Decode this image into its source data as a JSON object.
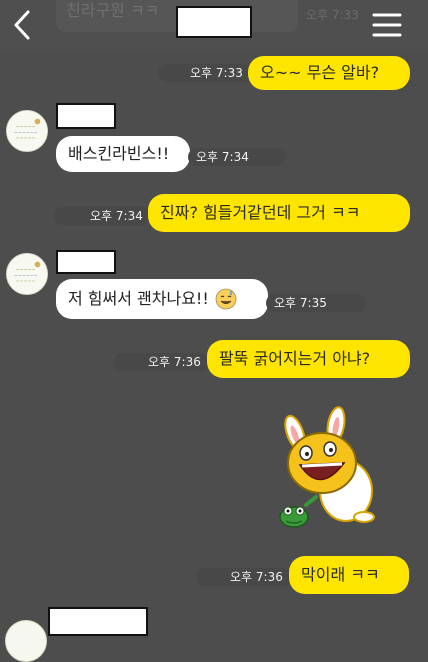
{
  "header": {
    "back_icon": "chevron-left-icon",
    "menu_icon": "hamburger-menu-icon"
  },
  "partial_top": {
    "text": "친라구원 ㅋㅋ",
    "time": "오후 7:33"
  },
  "messages": [
    {
      "side": "me",
      "text": "오~~ 무슨 알바?",
      "time": "오후 7:33"
    },
    {
      "side": "other",
      "text": "배스킨라빈스!!",
      "time": "오후 7:34"
    },
    {
      "side": "me",
      "text": "진짜? 힘들거같던데 그거 ㅋㅋ",
      "time": "오후 7:34"
    },
    {
      "side": "other",
      "text": "저 힘써서 괜차나요!!",
      "time": "오후 7:35",
      "emoji": "sweat-smile-emoji"
    },
    {
      "side": "me",
      "text": "팔뚝 굵어지는거 아냐?",
      "time": "오후 7:36"
    },
    {
      "side": "me",
      "kind": "sticker",
      "sticker": "kakao-muzi-with-frog-sticker"
    },
    {
      "side": "me",
      "text": "막이래 ㅋㅋ",
      "time": "오후 7:36"
    }
  ],
  "colors": {
    "background": "#4d4d4d",
    "my_bubble": "#fee500",
    "other_bubble": "#ffffff"
  }
}
